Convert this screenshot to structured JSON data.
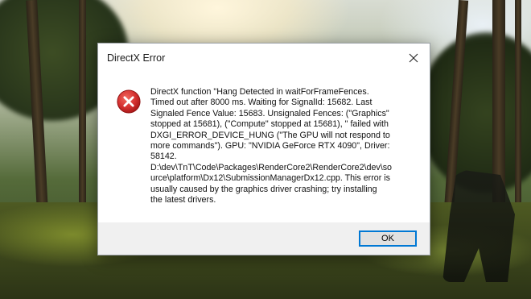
{
  "dialog": {
    "title": "DirectX Error",
    "icon": "error-icon",
    "message": "DirectX function \"Hang Detected in waitForFrameFences.\nTimed out after 8000 ms. Waiting for SignalId: 15682. Last\nSignaled Fence Value: 15683. Unsignaled Fences: (\"Graphics\"\nstopped at 15681), (\"Compute\" stopped at 15681), \" failed with\nDXGI_ERROR_DEVICE_HUNG (\"The GPU will not respond to\nmore commands\"). GPU: \"NVIDIA GeForce RTX 4090\", Driver:\n58142.\nD:\\dev\\TnT\\Code\\Packages\\RenderCore2\\RenderCore2\\dev\\so\nurce\\platform\\Dx12\\SubmissionManagerDx12.cpp. This error is\nusually caused by the graphics driver crashing; try installing\nthe latest drivers.",
    "ok_label": "OK"
  },
  "colors": {
    "error_red": "#d32f2f",
    "button_focus_border": "#0078d4",
    "footer_bg": "#f0f0f0"
  }
}
